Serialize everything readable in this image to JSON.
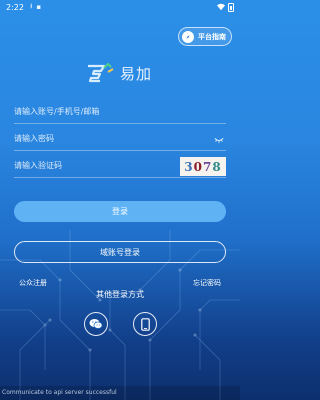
{
  "status_bar": {
    "time": "2:22",
    "icons": [
      "download-icon",
      "notification-icon",
      "wifi-icon",
      "battery-icon"
    ]
  },
  "guide_button": {
    "label": "平台指南",
    "icon": "compass-icon"
  },
  "logo": {
    "text": "易加"
  },
  "form": {
    "username_placeholder": "请输入账号/手机号/邮箱",
    "password_placeholder": "请输入密码",
    "captcha_placeholder": "请输入验证码",
    "captcha_chars": [
      "3",
      "0",
      "7",
      "8"
    ]
  },
  "buttons": {
    "login": "登录",
    "domain_login": "域账号登录"
  },
  "links": {
    "register": "公众注册",
    "forgot_password": "忘记密码"
  },
  "other_login": {
    "title": "其他登录方式",
    "options": [
      "wechat-icon",
      "phone-icon"
    ]
  },
  "toast": "Communicate to api server successful",
  "colors": {
    "background_top": "#2b8fe8",
    "background_bottom": "#0d2f6e",
    "login_button": "#5fb3f4",
    "text": "#ffffff"
  }
}
